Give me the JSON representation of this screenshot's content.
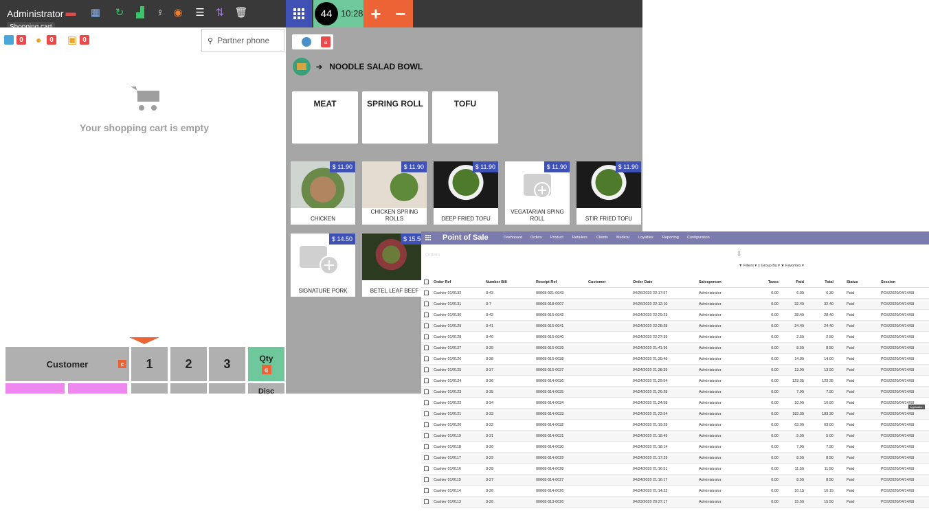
{
  "pos": {
    "user": "Administrator",
    "tooltip": "Shopping cart",
    "order_number": "44",
    "order_time": "10:28",
    "plus": "+",
    "minus": "−",
    "counters": [
      "0",
      "0",
      "0"
    ],
    "partner_placeholder": "Partner phone",
    "empty_cart": "Your shopping cart is empty",
    "breadcrumb": "NOODLE SALAD BOWL",
    "tag_count": "a",
    "categories": [
      "MEAT",
      "SPRING ROLL",
      "TOFU"
    ],
    "products": [
      {
        "name": "CHICKEN",
        "price": "$ 11.90"
      },
      {
        "name": "CHICKEN SPRING ROLLS",
        "price": "$ 11.90"
      },
      {
        "name": "DEEP FRIED TOFU",
        "price": "$ 11.90"
      },
      {
        "name": "VEGATARIAN SPING ROLL",
        "price": "$ 11.90"
      },
      {
        "name": "STIR FRIED TOFU",
        "price": "$ 11.90"
      },
      {
        "name": "SIGNATURE PORK",
        "price": "$ 14.50"
      },
      {
        "name": "BETEL LEAF BEEF",
        "price": "$ 15.50"
      }
    ],
    "numpad": {
      "customer": "Customer",
      "customer_key": "c",
      "keys": [
        "1",
        "2",
        "3"
      ],
      "qty": "Qty",
      "qty_key": "q",
      "disc": "Disc"
    },
    "colors": {
      "accent": "#ec6436",
      "blue": "#3f51b5",
      "green": "#6ec89b",
      "pink": "#ee88ee"
    }
  },
  "backend": {
    "brand": "Point of Sale",
    "menu": [
      "Dashboard",
      "Orders",
      "Product",
      "Retailers",
      "Clients",
      "Medical",
      "Loyalties",
      "Reporting",
      "Configuration"
    ],
    "breadcrumb": "Orders",
    "filters": "▼ Filters ▾   ≡ Group By ▾   ★ Favorites ▾",
    "tooltip": "Application",
    "columns": [
      "Order Ref",
      "Number Bill",
      "Receipt Ref",
      "Customer",
      "Order Date",
      "Salesperson",
      "Taxes",
      "Paid",
      "Total",
      "Status",
      "Session"
    ],
    "rows": [
      [
        "Cashier 01/0132",
        "3-43",
        "00068-021-0043",
        "",
        "04/26/2020 22:17:57",
        "Administrator",
        "0.00",
        "6.30",
        "6.30",
        "Paid",
        "POS/2020/04/14/68"
      ],
      [
        "Cashier 01/0131",
        "3-7",
        "00068-018-0007",
        "",
        "04/26/2020 22:12:10",
        "Administrator",
        "0.00",
        "32.40",
        "32.40",
        "Paid",
        "POS/2020/04/14/68"
      ],
      [
        "Cashier 01/0130",
        "3-42",
        "00068-015-0042",
        "",
        "04/24/2020 22:29:23",
        "Administrator",
        "0.00",
        "28.40",
        "28.40",
        "Paid",
        "POS/2020/04/14/68"
      ],
      [
        "Cashier 01/0129",
        "3-41",
        "00068-015-0041",
        "",
        "04/24/2020 22:28:28",
        "Administrator",
        "0.00",
        "24.40",
        "24.40",
        "Paid",
        "POS/2020/04/14/68"
      ],
      [
        "Cashier 01/0128",
        "3-40",
        "00068-015-0040",
        "",
        "04/24/2020 22:27:39",
        "Administrator",
        "0.00",
        "2.50",
        "2.50",
        "Paid",
        "POS/2020/04/14/68"
      ],
      [
        "Cashier 01/0127",
        "3-39",
        "00068-015-0039",
        "",
        "04/24/2020 21:41:36",
        "Administrator",
        "0.00",
        "8.50",
        "8.50",
        "Paid",
        "POS/2020/04/14/68"
      ],
      [
        "Cashier 01/0126",
        "3-38",
        "00068-015-0038",
        "",
        "04/24/2020 21:39:45",
        "Administrator",
        "0.00",
        "14.00",
        "14.00",
        "Paid",
        "POS/2020/04/14/68"
      ],
      [
        "Cashier 01/0125",
        "3-37",
        "00068-015-0037",
        "",
        "04/24/2020 21:38:39",
        "Administrator",
        "0.00",
        "13.90",
        "13.90",
        "Paid",
        "POS/2020/04/14/68"
      ],
      [
        "Cashier 01/0124",
        "3-36",
        "00068-014-0036",
        "",
        "04/24/2020 21:29:54",
        "Administrator",
        "0.00",
        "123.35",
        "123.35",
        "Paid",
        "POS/2020/04/14/68"
      ],
      [
        "Cashier 01/0123",
        "3-35",
        "00068-014-0035",
        "",
        "04/24/2020 21:26:28",
        "Administrator",
        "0.00",
        "7.90",
        "7.90",
        "Paid",
        "POS/2020/04/14/68"
      ],
      [
        "Cashier 01/0122",
        "3-34",
        "00068-014-0034",
        "",
        "04/24/2020 21:24:58",
        "Administrator",
        "0.00",
        "10.90",
        "10.90",
        "Paid",
        "POS/2020/04/14/68"
      ],
      [
        "Cashier 01/0121",
        "3-33",
        "00068-014-0033",
        "",
        "04/24/2020 21:23:54",
        "Administrator",
        "0.00",
        "183.30",
        "183.30",
        "Paid",
        "POS/2020/04/14/68"
      ],
      [
        "Cashier 01/0120",
        "3-32",
        "00068-014-0032",
        "",
        "04/24/2020 21:19:29",
        "Administrator",
        "0.00",
        "63.00",
        "63.00",
        "Paid",
        "POS/2020/04/14/68"
      ],
      [
        "Cashier 01/0119",
        "3-31",
        "00068-014-0031",
        "",
        "04/24/2020 21:18:49",
        "Administrator",
        "0.00",
        "5.00",
        "5.00",
        "Paid",
        "POS/2020/04/14/68"
      ],
      [
        "Cashier 01/0118",
        "3-30",
        "00068-014-0030",
        "",
        "04/24/2020 21:18:14",
        "Administrator",
        "0.00",
        "7.90",
        "7.90",
        "Paid",
        "POS/2020/04/14/68"
      ],
      [
        "Cashier 01/0117",
        "3-29",
        "00068-014-0029",
        "",
        "04/24/2020 21:17:29",
        "Administrator",
        "0.00",
        "8.50",
        "8.50",
        "Paid",
        "POS/2020/04/14/68"
      ],
      [
        "Cashier 01/0116",
        "3-28",
        "00068-014-0028",
        "",
        "04/24/2020 21:16:51",
        "Administrator",
        "0.00",
        "11.50",
        "11.50",
        "Paid",
        "POS/2020/04/14/68"
      ],
      [
        "Cashier 01/0115",
        "3-27",
        "00068-014-0027",
        "",
        "04/24/2020 21:16:17",
        "Administrator",
        "0.00",
        "8.50",
        "8.50",
        "Paid",
        "POS/2020/04/14/68"
      ],
      [
        "Cashier 01/0114",
        "3-26",
        "00068-014-0026",
        "",
        "04/24/2020 21:14:22",
        "Administrator",
        "0.00",
        "10.15",
        "10.15",
        "Paid",
        "POS/2020/04/14/68"
      ],
      [
        "Cashier 01/0113",
        "3-26",
        "00068-013-0026",
        "",
        "04/23/2020 20:27:17",
        "Administrator",
        "0.00",
        "15.50",
        "15.50",
        "Paid",
        "POS/2020/04/14/68"
      ]
    ]
  }
}
